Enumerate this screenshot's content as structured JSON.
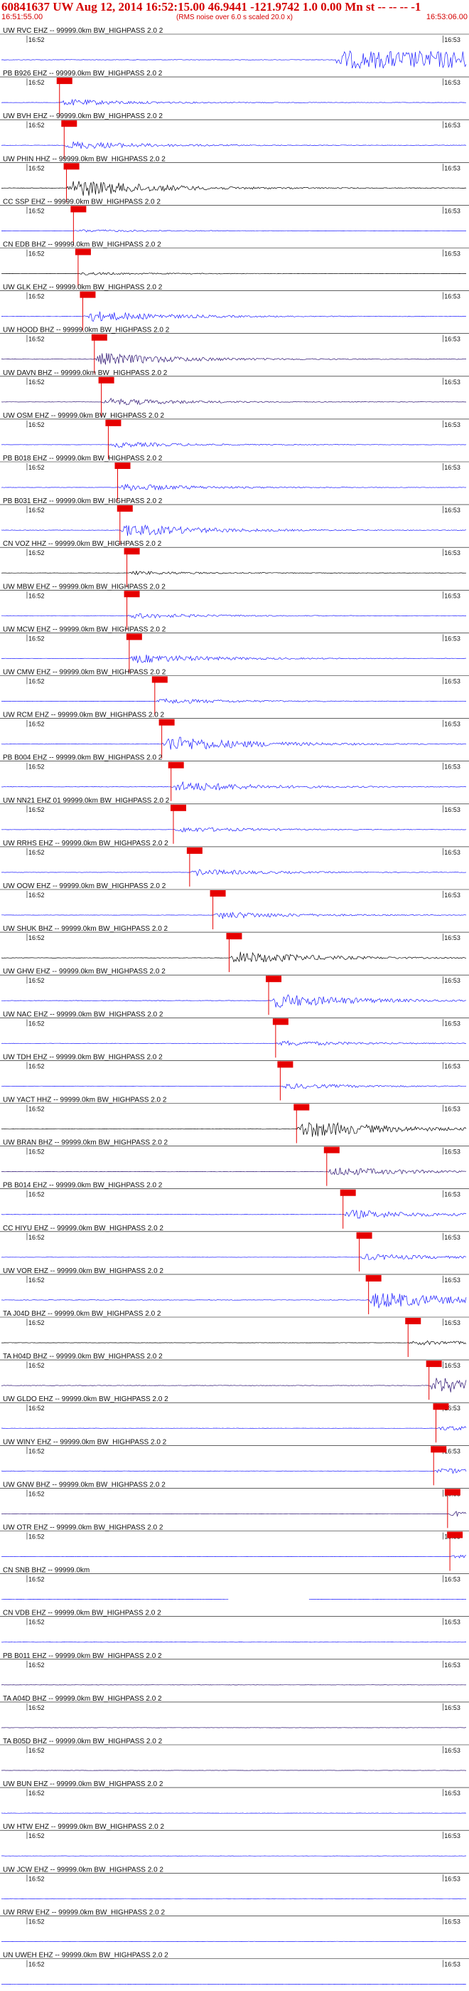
{
  "header": {
    "title": "60841637 UW Aug 12, 2014 16:52:15.00   46.9441 -121.9742  1.0 0.00 Mn st -- -- --   -1",
    "start_time": "16:51:55.00",
    "end_time": "16:53:06.00",
    "note": "(RMS noise over 6.0 s scaled 20.0 x)"
  },
  "colors": {
    "trace_blue": "#1a1aff",
    "trace_black": "#000000",
    "trace_purple": "#2a1070",
    "pick": "#e60000",
    "text": "#111111"
  },
  "chart_data": {
    "type": "line",
    "title": "60841637 UW Aug 12, 2014 16:52:15.00",
    "time_ticks": [
      "16:52",
      "16:53"
    ],
    "traces": [
      {
        "label": "UW RVC EHZ -- 99999.0km BW_HIGHPASS  2.0  2",
        "color": "blue",
        "pick": null,
        "amp": 1.0,
        "burst": [
          0.72,
          1.0
        ]
      },
      {
        "label": "PB B926 EHZ -- 99999.0km BW_HIGHPASS  2.0  2",
        "color": "blue",
        "pick": 0.125,
        "amp": 0.35
      },
      {
        "label": "UW BVH EHZ -- 99999.0km BW_HIGHPASS  2.0  2",
        "color": "blue",
        "pick": 0.135,
        "amp": 0.45
      },
      {
        "label": "UW PHIN HHZ -- 99999.0km BW_HIGHPASS  2.0  2",
        "color": "black",
        "pick": 0.14,
        "amp": 1.0
      },
      {
        "label": "CC SSP EHZ -- 99999.0km BW_HIGHPASS  2.0  2",
        "color": "blue",
        "pick": 0.155,
        "amp": 0.15
      },
      {
        "label": "CN EDB BHZ -- 99999.0km BW_HIGHPASS  2.0  2",
        "color": "black",
        "pick": 0.165,
        "amp": 0.15
      },
      {
        "label": "UW GLK EHZ -- 99999.0km BW_HIGHPASS  2.0  2",
        "color": "blue",
        "pick": 0.175,
        "amp": 0.6
      },
      {
        "label": "UW HOOD BHZ -- 99999.0km BW_HIGHPASS  2.0  2",
        "color": "purple",
        "pick": 0.2,
        "amp": 0.7
      },
      {
        "label": "UW DAVN BHZ -- 99999.0km BW_HIGHPASS  2.0  2",
        "color": "purple",
        "pick": 0.215,
        "amp": 0.4
      },
      {
        "label": "UW OSM EHZ -- 99999.0km BW_HIGHPASS  2.0  2",
        "color": "blue",
        "pick": 0.23,
        "amp": 0.3
      },
      {
        "label": "PB B018 EHZ -- 99999.0km BW_HIGHPASS  2.0  2",
        "color": "blue",
        "pick": 0.25,
        "amp": 0.4
      },
      {
        "label": "PB B031 EHZ -- 99999.0km BW_HIGHPASS  2.0  2",
        "color": "blue",
        "pick": 0.255,
        "amp": 0.7
      },
      {
        "label": "CN VOZ HHZ -- 99999.0km BW_HIGHPASS  2.0  2",
        "color": "black",
        "pick": 0.27,
        "amp": 0.2
      },
      {
        "label": "UW MBW EHZ -- 99999.0km BW_HIGHPASS  2.0  2",
        "color": "blue",
        "pick": 0.27,
        "amp": 0.3
      },
      {
        "label": "UW MCW EHZ -- 99999.0km BW_HIGHPASS  2.0  2",
        "color": "blue",
        "pick": 0.275,
        "amp": 0.5
      },
      {
        "label": "UW CMW EHZ -- 99999.0km BW_HIGHPASS  2.0  2",
        "color": "blue",
        "pick": 0.33,
        "amp": 0.3
      },
      {
        "label": "UW RCM EHZ -- 99999.0km BW_HIGHPASS  2.0  2",
        "color": "blue",
        "pick": 0.345,
        "amp": 0.9
      },
      {
        "label": "PB B004 EHZ -- 99999.0km BW_HIGHPASS  2.0  2",
        "color": "blue",
        "pick": 0.365,
        "amp": 0.6
      },
      {
        "label": "UW NN21 EHZ 01 99999.0km BW_HIGHPASS  2.0  2",
        "color": "blue",
        "pick": 0.37,
        "amp": 0.3
      },
      {
        "label": "UW RRHS EHZ -- 99999.0km BW_HIGHPASS  2.0  2",
        "color": "blue",
        "pick": 0.405,
        "amp": 0.35
      },
      {
        "label": "UW OOW EHZ -- 99999.0km BW_HIGHPASS  2.0  2",
        "color": "blue",
        "pick": 0.455,
        "amp": 0.4
      },
      {
        "label": "UW SHUK BHZ -- 99999.0km BW_HIGHPASS  2.0  2",
        "color": "black",
        "pick": 0.49,
        "amp": 0.7
      },
      {
        "label": "UW GHW EHZ -- 99999.0km BW_HIGHPASS  2.0  2",
        "color": "blue",
        "pick": 0.575,
        "amp": 0.8
      },
      {
        "label": "UW NAC EHZ -- 99999.0km BW_HIGHPASS  2.0  2",
        "color": "blue",
        "pick": 0.59,
        "amp": 0.3
      },
      {
        "label": "UW TDH EHZ -- 99999.0km BW_HIGHPASS  2.0  2",
        "color": "blue",
        "pick": 0.6,
        "amp": 0.3
      },
      {
        "label": "UW YACT HHZ -- 99999.0km BW_HIGHPASS  2.0  2",
        "color": "black",
        "pick": 0.635,
        "amp": 1.0
      },
      {
        "label": "UW BRAN BHZ -- 99999.0km BW_HIGHPASS  2.0  2",
        "color": "purple",
        "pick": 0.7,
        "amp": 0.5
      },
      {
        "label": "PB B014 EHZ -- 99999.0km BW_HIGHPASS  2.0  2",
        "color": "blue",
        "pick": 0.735,
        "amp": 0.5
      },
      {
        "label": "CC HIYU EHZ -- 99999.0km BW_HIGHPASS  2.0  2",
        "color": "blue",
        "pick": 0.77,
        "amp": 0.35
      },
      {
        "label": "UW VOR EHZ -- 99999.0km BW_HIGHPASS  2.0  2",
        "color": "blue",
        "pick": 0.79,
        "amp": 1.0
      },
      {
        "label": "TA J04D BHZ -- 99999.0km BW_HIGHPASS  2.0  2",
        "color": "black",
        "pick": 0.875,
        "amp": 0.25
      },
      {
        "label": "TA H04D BHZ -- 99999.0km BW_HIGHPASS  2.0  2",
        "color": "purple",
        "pick": 0.92,
        "amp": 0.9
      },
      {
        "label": "UW GLDO EHZ -- 99999.0km BW_HIGHPASS  2.0  2",
        "color": "blue",
        "pick": 0.935,
        "amp": 0.25
      },
      {
        "label": "UW WINY EHZ -- 99999.0km BW_HIGHPASS  2.0  2",
        "color": "blue",
        "pick": 0.93,
        "amp": 0.3
      },
      {
        "label": "UW GNW BHZ -- 99999.0km BW_HIGHPASS  2.0  2",
        "color": "purple",
        "pick": 0.96,
        "amp": 0.3
      },
      {
        "label": "UW OTR EHZ -- 99999.0km BW_HIGHPASS  2.0  2",
        "color": "blue",
        "pick": 0.965,
        "amp": 0.35
      },
      {
        "label": "CN SNB BHZ -- 99999.0km",
        "color": "blue",
        "pick": null,
        "amp": 0.2,
        "gap": [
          0.49,
          0.66
        ]
      },
      {
        "label": "CN VDB EHZ -- 99999.0km BW_HIGHPASS  2.0  2",
        "color": "blue",
        "pick": null,
        "amp": 0.3
      },
      {
        "label": "PB B011 EHZ -- 99999.0km BW_HIGHPASS  2.0  2",
        "color": "purple",
        "pick": null,
        "amp": 0.3
      },
      {
        "label": "TA A04D BHZ -- 99999.0km BW_HIGHPASS  2.0  2",
        "color": "purple",
        "pick": null,
        "amp": 0.3
      },
      {
        "label": "TA B05D BHZ -- 99999.0km BW_HIGHPASS  2.0  2",
        "color": "purple",
        "pick": null,
        "amp": 0.25
      },
      {
        "label": "UW BUN EHZ -- 99999.0km BW_HIGHPASS  2.0  2",
        "color": "blue",
        "pick": null,
        "amp": 0.3
      },
      {
        "label": "UW HTW EHZ -- 99999.0km BW_HIGHPASS  2.0  2",
        "color": "blue",
        "pick": null,
        "amp": 0.3
      },
      {
        "label": "UW JCW EHZ -- 99999.0km BW_HIGHPASS  2.0  2",
        "color": "blue",
        "pick": null,
        "amp": 0.3
      },
      {
        "label": "UW RRW EHZ -- 99999.0km BW_HIGHPASS  2.0  2",
        "color": "blue",
        "pick": null,
        "amp": 0.3
      },
      {
        "label": "UN UWEH EHZ -- 99999.0km BW_HIGHPASS  2.0  2",
        "color": "blue",
        "pick": null,
        "amp": 0.3
      }
    ]
  }
}
